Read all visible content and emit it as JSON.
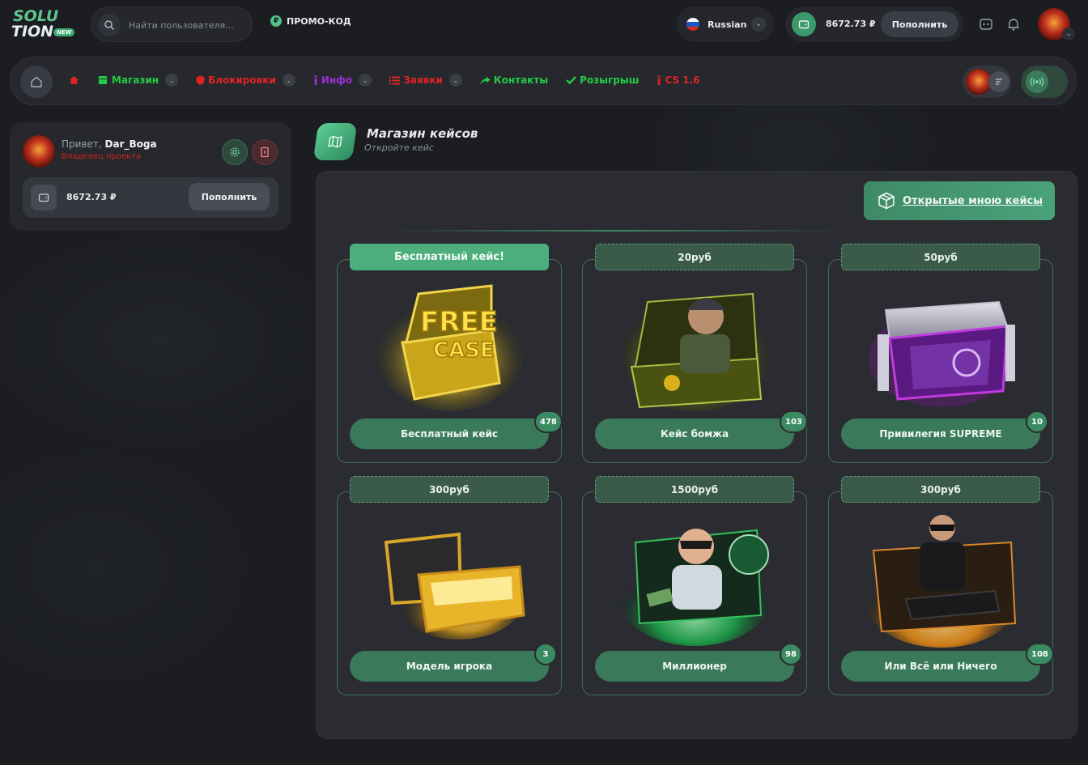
{
  "logo": {
    "line1": "SOLU",
    "line2": "TION",
    "badge": "NEW"
  },
  "search": {
    "placeholder": "Найти пользователя..."
  },
  "promo": {
    "icon_glyph": "₽",
    "label": "ПРОМО-КОД"
  },
  "language": {
    "selected": "Russian"
  },
  "wallet": {
    "balance": "8672.73 ₽",
    "topup_label": "Пополнить"
  },
  "nav": {
    "items": [
      {
        "label": "",
        "color": "#e02424",
        "icon": "home-icon"
      },
      {
        "label": "Магазин",
        "color": "#22cc44",
        "icon": "store-icon",
        "dropdown": true
      },
      {
        "label": "Блокировки",
        "color": "#e02424",
        "icon": "shield-icon",
        "dropdown": true
      },
      {
        "label": "Инфо",
        "color": "#9b2fd6",
        "icon": "info-icon",
        "dropdown": true
      },
      {
        "label": "Заявки",
        "color": "#e02424",
        "icon": "list-icon",
        "dropdown": true
      },
      {
        "label": "Контакты",
        "color": "#22cc44",
        "icon": "share-icon"
      },
      {
        "label": "Розыгрыш",
        "color": "#22cc44",
        "icon": "check-icon"
      },
      {
        "label": "CS 1.6",
        "color": "#e02424",
        "icon": "info-i-icon"
      }
    ]
  },
  "profile": {
    "greeting": "Привет, ",
    "username": "Dar_Boga",
    "role": "Владелец проекта",
    "balance": "8672.73 ₽",
    "topup_label": "Пополнить"
  },
  "shop": {
    "title": "Магазин кейсов",
    "subtitle": "Откройте кейс",
    "opened_cases_label": "Открытые мною кейсы"
  },
  "cases": [
    {
      "price": "Бесплатный кейс!",
      "name": "Бесплатный кейс",
      "count": "478",
      "free": true,
      "art_text_1": "FREE",
      "art_text_2": "CASE"
    },
    {
      "price": "20руб",
      "name": "Кейс бомжа",
      "count": "103"
    },
    {
      "price": "50руб",
      "name": "Привилегия SUPREME",
      "count": "10"
    },
    {
      "price": "300руб",
      "name": "Модель игрока",
      "count": "3"
    },
    {
      "price": "1500руб",
      "name": "Миллионер",
      "count": "98"
    },
    {
      "price": "300руб",
      "name": "Или Всё или Ничего",
      "count": "108"
    }
  ],
  "colors": {
    "accent": "#4cae7c",
    "danger": "#d8221c",
    "bg": "#1b1d21"
  }
}
